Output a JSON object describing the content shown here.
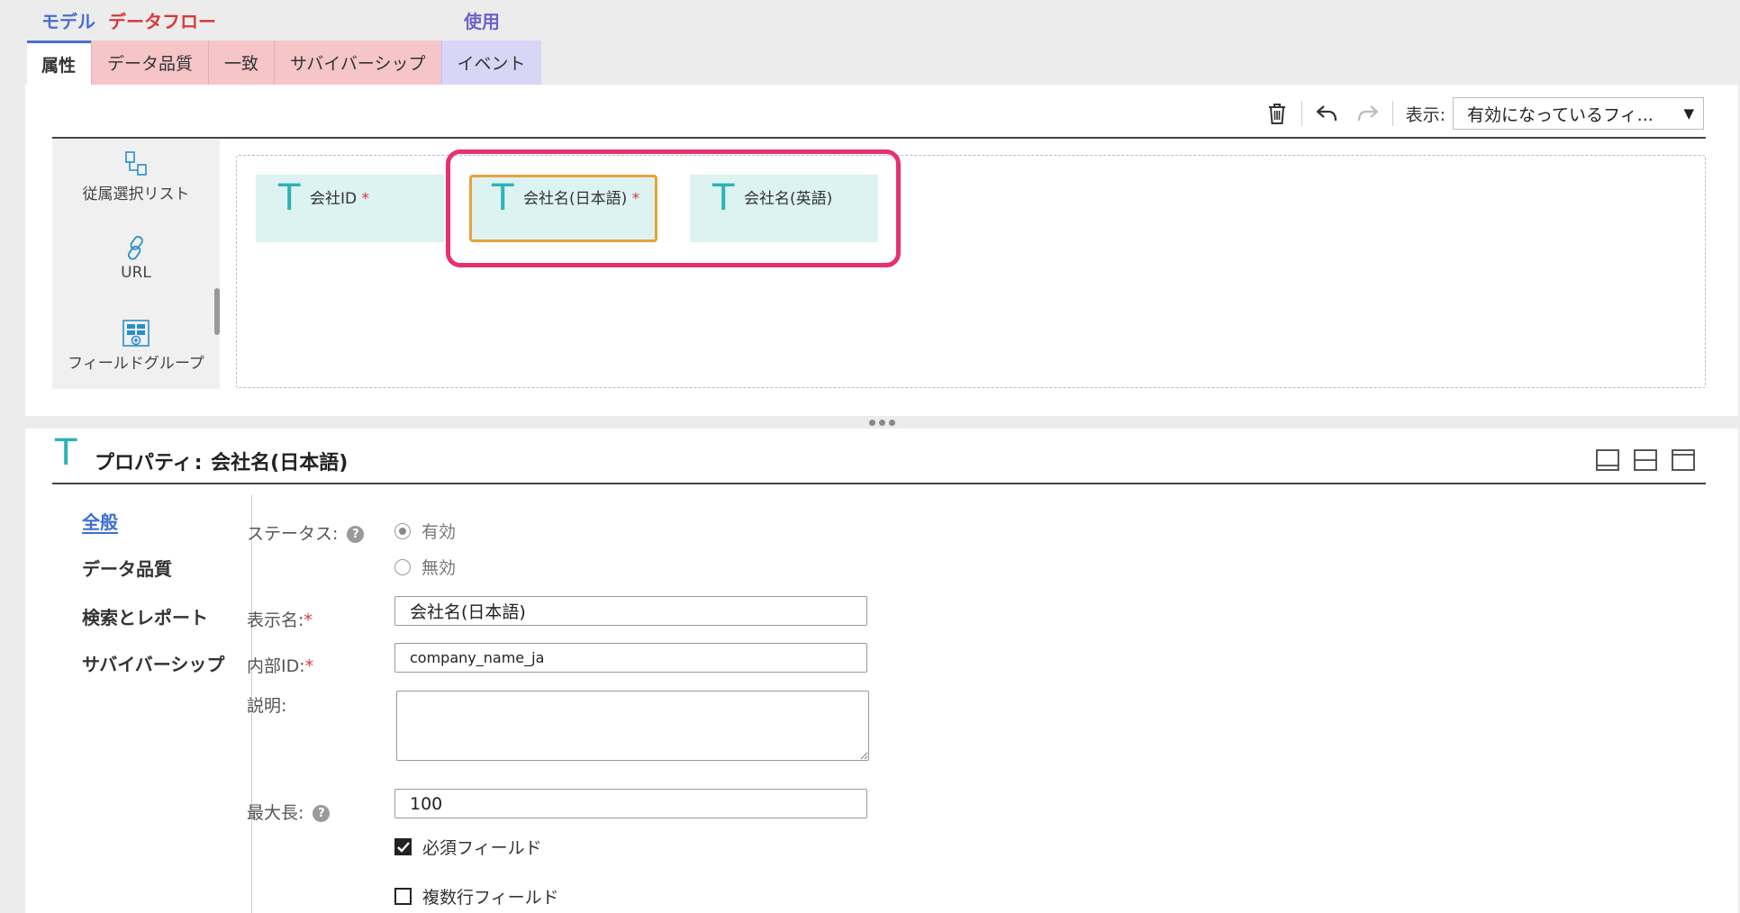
{
  "categories": {
    "model": "モデル",
    "dataflow": "データフロー",
    "use": "使用"
  },
  "tabs": [
    {
      "label": "属性"
    },
    {
      "label": "データ品質"
    },
    {
      "label": "一致"
    },
    {
      "label": "サバイバーシップ"
    },
    {
      "label": "イベント"
    }
  ],
  "toolbar": {
    "display_label": "表示:",
    "display_value": "有効になっているフィ..."
  },
  "palette": [
    {
      "label": "従属選択リスト",
      "icon": "dependent-picklist-icon"
    },
    {
      "label": "URL",
      "icon": "link-icon"
    },
    {
      "label": "フィールドグループ",
      "icon": "field-group-icon"
    }
  ],
  "fields": [
    {
      "type_glyph": "T",
      "name": "会社ID",
      "required_mark": "*"
    },
    {
      "type_glyph": "T",
      "name": "会社名(日本語)",
      "required_mark": "*"
    },
    {
      "type_glyph": "T",
      "name": "会社名(英語)",
      "required_mark": ""
    }
  ],
  "properties": {
    "type_glyph": "T",
    "title_prefix": "プロパティ",
    "title_sep": ":",
    "title_name": "会社名(日本語)"
  },
  "nav": [
    {
      "label": "全般"
    },
    {
      "label": "データ品質"
    },
    {
      "label": "検索とレポート"
    },
    {
      "label": "サバイバーシップ"
    }
  ],
  "form": {
    "status_label": "ステータス:",
    "help_glyph": "?",
    "status_active": "有効",
    "status_inactive": "無効",
    "display_name_label": "表示名:",
    "display_name_value": "会社名(日本語)",
    "internal_id_label": "内部ID:",
    "internal_id_value": "company_name_ja",
    "description_label": "説明:",
    "max_length_label": "最大長:",
    "max_length_value": "100",
    "required_field_label": "必須フィールド",
    "multiline_field_label": "複数行フィールド",
    "required_mark": "*"
  }
}
